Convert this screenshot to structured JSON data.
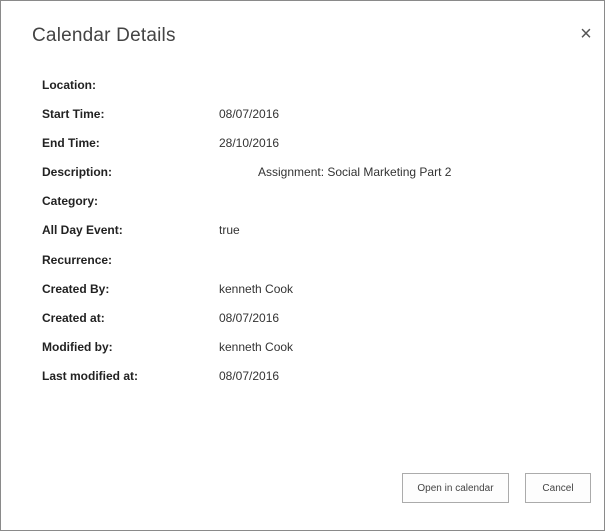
{
  "dialog": {
    "title": "Calendar Details",
    "close_label": "×"
  },
  "fields": [
    {
      "label": "Location:",
      "value": ""
    },
    {
      "label": "Start Time:",
      "value": "08/07/2016"
    },
    {
      "label": "End Time:",
      "value": "28/10/2016"
    },
    {
      "label": "Description:",
      "value": "Assignment:  Social Marketing Part 2"
    },
    {
      "label": "Category:",
      "value": ""
    },
    {
      "label": "All Day Event:",
      "value": "true"
    },
    {
      "label": "Recurrence:",
      "value": ""
    },
    {
      "label": "Created By:",
      "value": "kenneth Cook"
    },
    {
      "label": "Created at:",
      "value": "08/07/2016"
    },
    {
      "label": "Modified by:",
      "value": "kenneth Cook"
    },
    {
      "label": "Last modified at:",
      "value": "08/07/2016"
    }
  ],
  "buttons": {
    "open_label": "Open in calendar",
    "cancel_label": "Cancel"
  }
}
